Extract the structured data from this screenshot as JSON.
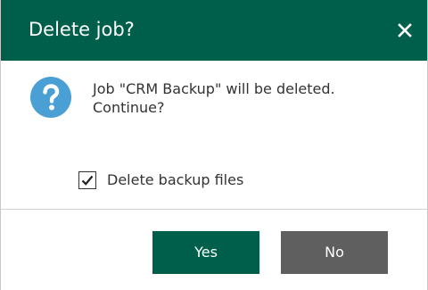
{
  "dialog": {
    "title": "Delete job?",
    "message_line1": "Job \"CRM Backup\" will be deleted.",
    "message_line2": "Continue?",
    "checkbox": {
      "label": "Delete backup files",
      "checked": true
    },
    "buttons": {
      "yes_label": "Yes",
      "no_label": "No"
    }
  },
  "icons": {
    "close": "close-icon",
    "question": "question-icon",
    "check": "checkmark-icon"
  },
  "colors": {
    "titlebar": "#005f4b",
    "primary_button": "#005f4b",
    "secondary_button": "#5f5f5f",
    "question_icon": "#4a9fd5"
  }
}
